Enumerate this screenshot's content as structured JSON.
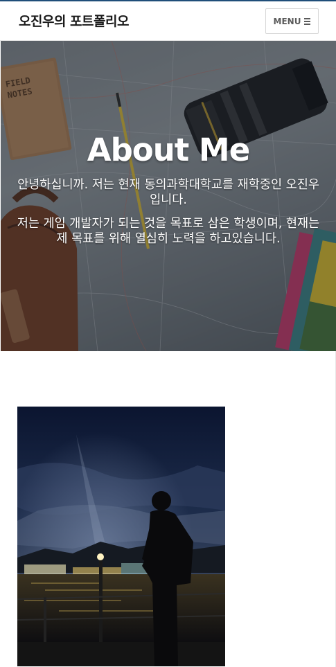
{
  "header": {
    "brand": "오진우의 포트폴리오",
    "menu_label": "MENU",
    "menu_icon": "hamburger-icon"
  },
  "hero": {
    "title": "About Me",
    "paragraph_1": "안녕하십니까. 저는 현재 동의과학대학교를 재학중인 오진우 입니다.",
    "paragraph_2": "저는 게임 개발자가 되는 것을 목표로 삼은 학생이며, 현재는 제 목표를 위해 열심히 노력을 하고있습니다.",
    "notebook_label_line1": "FIELD",
    "notebook_label_line2": "NOTES"
  },
  "colors": {
    "topline": "#1f4e79",
    "hero_overlay": "rgba(25,30,40,0.42)",
    "text_light": "#ffffff"
  }
}
